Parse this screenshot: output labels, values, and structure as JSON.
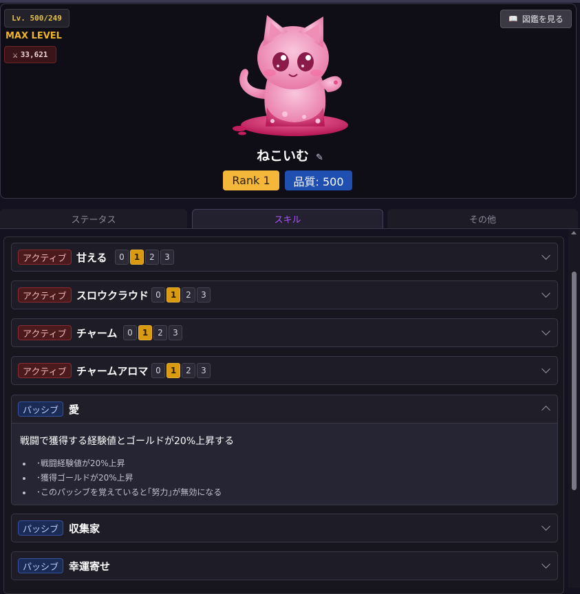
{
  "header": {
    "level_badge": "Lv. 500/249",
    "max_level": "MAX LEVEL",
    "power": "33,621",
    "power_icon": "crossed-swords-icon",
    "dex_button_icon": "book-icon",
    "dex_button": "図鑑を見る"
  },
  "pet": {
    "name": "ねこいむ",
    "edit_icon": "edit-icon",
    "rank": "Rank 1",
    "quality": "品質: 500",
    "image": "pink-slime-cat"
  },
  "tabs": [
    {
      "label": "ステータス",
      "active": false
    },
    {
      "label": "スキル",
      "active": true
    },
    {
      "label": "その他",
      "active": false
    }
  ],
  "skills": [
    {
      "type": "アクティブ",
      "name": "甘える",
      "levels": [
        "0",
        "1",
        "2",
        "3"
      ],
      "selected": "1",
      "expanded": false
    },
    {
      "type": "アクティブ",
      "name": "スロウクラウド",
      "levels": [
        "0",
        "1",
        "2",
        "3"
      ],
      "selected": "1",
      "expanded": false
    },
    {
      "type": "アクティブ",
      "name": "チャーム",
      "levels": [
        "0",
        "1",
        "2",
        "3"
      ],
      "selected": "1",
      "expanded": false
    },
    {
      "type": "アクティブ",
      "name": "チャームアロマ",
      "levels": [
        "0",
        "1",
        "2",
        "3"
      ],
      "selected": "1",
      "expanded": false
    },
    {
      "type": "パッシブ",
      "name": "愛",
      "expanded": true,
      "description": "戦闘で獲得する経験値とゴールドが20%上昇する",
      "details": [
        "･戦闘経験値が20%上昇",
        "･獲得ゴールドが20%上昇",
        "･このパッシブを覚えていると｢努力｣が無効になる"
      ]
    },
    {
      "type": "パッシブ",
      "name": "収集家",
      "expanded": false
    },
    {
      "type": "パッシブ",
      "name": "幸運寄せ",
      "expanded": false
    }
  ],
  "colors": {
    "accent_tab": "#a855f7",
    "rank": "#f4b73a",
    "quality": "#1f4fb0",
    "active_tag": "#8c2c31",
    "passive_tag": "#3552a0",
    "level_selected": "#d99a0f"
  }
}
